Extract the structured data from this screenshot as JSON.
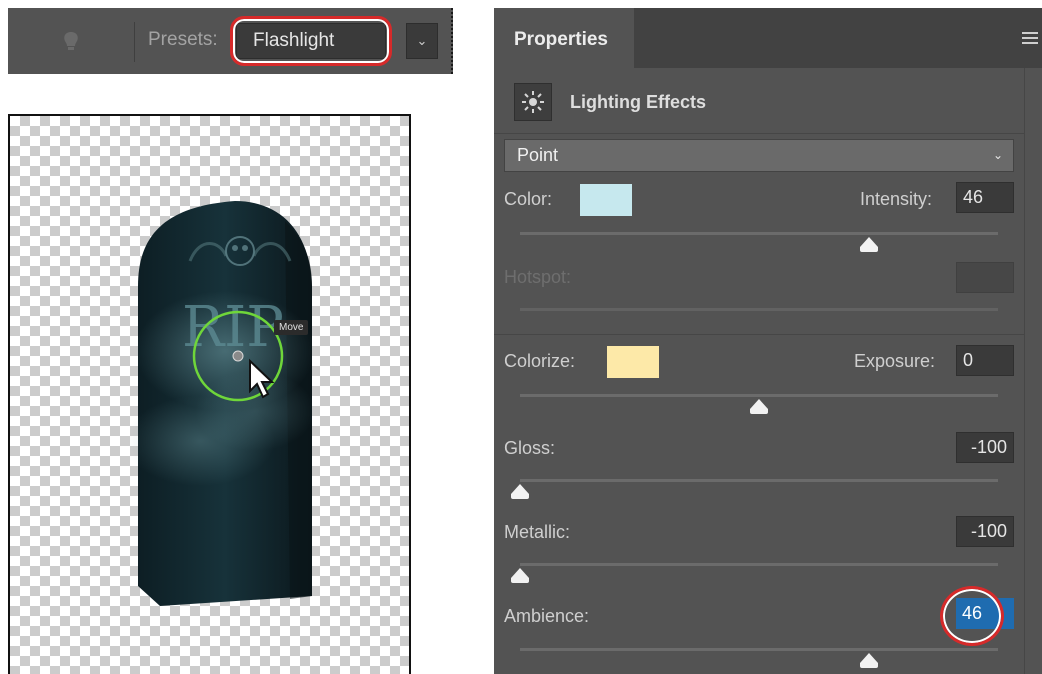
{
  "options_bar": {
    "presets_label": "Presets:",
    "preset_value": "Flashlight",
    "icons": {
      "light": "lightbulb-icon",
      "dropdown": "chevron-down-icon"
    }
  },
  "canvas": {
    "tooltip": "Move",
    "artwork": "tombstone-image"
  },
  "panel": {
    "tab": "Properties",
    "header_title": "Lighting Effects",
    "light_type": "Point",
    "color_label": "Color:",
    "color_swatch": "#c6e8ee",
    "intensity_label": "Intensity:",
    "intensity_value": "46",
    "intensity_level": 0.73,
    "hotspot_label": "Hotspot:",
    "colorize_label": "Colorize:",
    "colorize_swatch": "#fde9a8",
    "exposure_label": "Exposure:",
    "exposure_value": "0",
    "exposure_level": 0.5,
    "gloss_label": "Gloss:",
    "gloss_value": "-100",
    "gloss_level": 0.0,
    "metallic_label": "Metallic:",
    "metallic_value": "-100",
    "metallic_level": 0.0,
    "ambience_label": "Ambience:",
    "ambience_value": "46",
    "ambience_level": 0.73
  },
  "colors": {
    "highlight_ring": "#d62a2a",
    "ambience_active": "#1f6cb0"
  }
}
